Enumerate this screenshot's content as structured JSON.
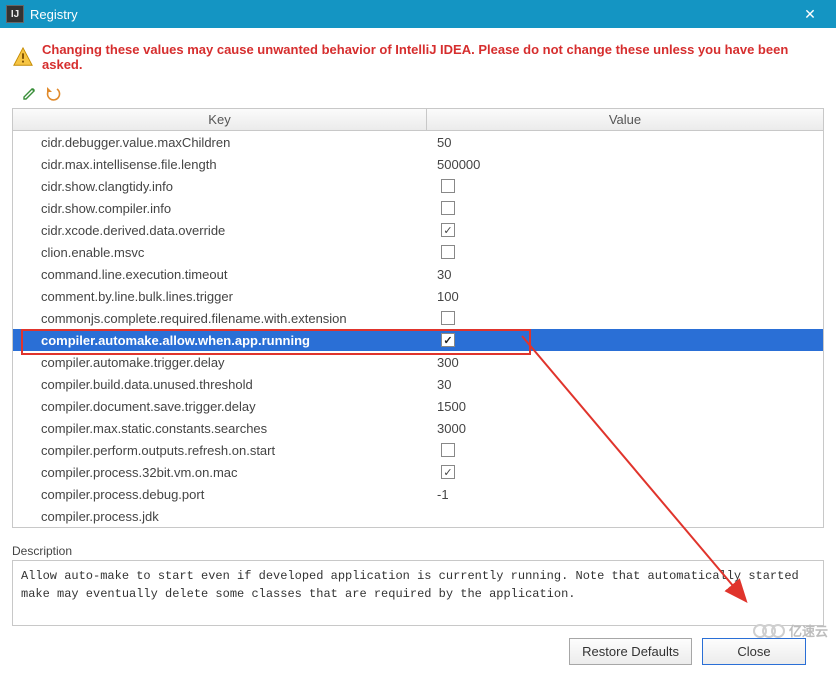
{
  "window": {
    "title": "Registry"
  },
  "warning": "Changing these values may cause unwanted behavior of IntelliJ IDEA. Please do not change these unless you have been asked.",
  "headers": {
    "key": "Key",
    "value": "Value"
  },
  "rows": [
    {
      "key": "cidr.debugger.value.maxChildren",
      "value": "50",
      "type": "text"
    },
    {
      "key": "cidr.max.intellisense.file.length",
      "value": "500000",
      "type": "text"
    },
    {
      "key": "cidr.show.clangtidy.info",
      "value": false,
      "type": "bool"
    },
    {
      "key": "cidr.show.compiler.info",
      "value": false,
      "type": "bool"
    },
    {
      "key": "cidr.xcode.derived.data.override",
      "value": true,
      "type": "bool"
    },
    {
      "key": "clion.enable.msvc",
      "value": false,
      "type": "bool"
    },
    {
      "key": "command.line.execution.timeout",
      "value": "30",
      "type": "text"
    },
    {
      "key": "comment.by.line.bulk.lines.trigger",
      "value": "100",
      "type": "text"
    },
    {
      "key": "commonjs.complete.required.filename.with.extension",
      "value": false,
      "type": "bool"
    },
    {
      "key": "compiler.automake.allow.when.app.running",
      "value": true,
      "type": "bool",
      "selected": true
    },
    {
      "key": "compiler.automake.trigger.delay",
      "value": "300",
      "type": "text"
    },
    {
      "key": "compiler.build.data.unused.threshold",
      "value": "30",
      "type": "text"
    },
    {
      "key": "compiler.document.save.trigger.delay",
      "value": "1500",
      "type": "text"
    },
    {
      "key": "compiler.max.static.constants.searches",
      "value": "3000",
      "type": "text"
    },
    {
      "key": "compiler.perform.outputs.refresh.on.start",
      "value": false,
      "type": "bool"
    },
    {
      "key": "compiler.process.32bit.vm.on.mac",
      "value": true,
      "type": "bool"
    },
    {
      "key": "compiler.process.debug.port",
      "value": "-1",
      "type": "text"
    },
    {
      "key": "compiler.process.jdk",
      "value": "",
      "type": "text"
    }
  ],
  "desc": {
    "label": "Description",
    "text": "Allow auto-make to start even if developed application is currently running. Note that automatically started make may eventually delete some classes that are required by the application."
  },
  "buttons": {
    "restore": "Restore Defaults",
    "close": "Close"
  },
  "watermark": "亿速云"
}
